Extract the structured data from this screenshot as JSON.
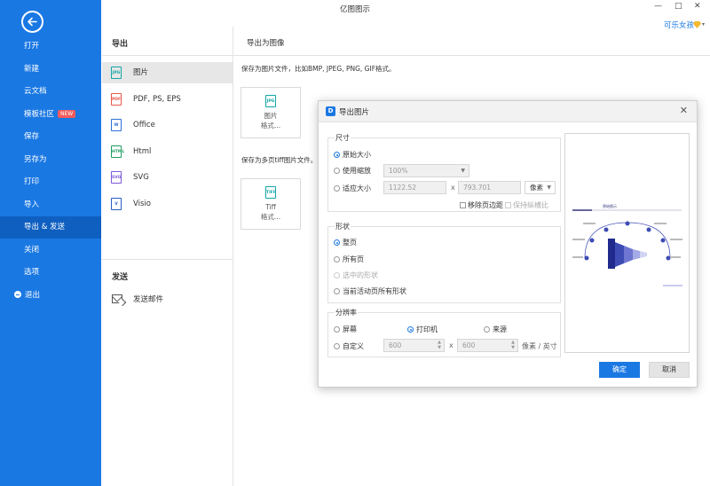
{
  "window": {
    "title": "亿图图示",
    "minimize": "—",
    "maximize": "□",
    "close": "✕",
    "user_name": "可乐女孩",
    "user_caret": "▾"
  },
  "sidebar": {
    "items": [
      {
        "label": "打开"
      },
      {
        "label": "新建"
      },
      {
        "label": "云文档"
      },
      {
        "label": "模板社区",
        "badge": "NEW"
      },
      {
        "label": "保存"
      },
      {
        "label": "另存为"
      },
      {
        "label": "打印"
      },
      {
        "label": "导入"
      },
      {
        "label": "导出 & 发送"
      },
      {
        "label": "关闭"
      },
      {
        "label": "选项"
      },
      {
        "label": "退出"
      }
    ]
  },
  "export_panel": {
    "export_title": "导出",
    "export_items": [
      {
        "icon_text": "JPG",
        "label": "图片"
      },
      {
        "icon_text": "PDF",
        "label": "PDF, PS, EPS"
      },
      {
        "icon_text": "W",
        "label": "Office"
      },
      {
        "icon_text": "HTML",
        "label": "Html"
      },
      {
        "icon_text": "SVG",
        "label": "SVG"
      },
      {
        "icon_text": "V",
        "label": "Visio"
      }
    ],
    "send_title": "发送",
    "send_items": [
      {
        "label": "发送邮件"
      }
    ]
  },
  "content": {
    "tab_title": "导出为图像",
    "desc1": "保存为图片文件，比如BMP, JPEG, PNG, GIF格式。",
    "card1": {
      "icon_text": "JPG",
      "line1": "图片",
      "line2": "格式..."
    },
    "desc2": "保存为多页tiff图片文件。",
    "card2": {
      "icon_text": "TIFF",
      "line1": "Tiff",
      "line2": "格式..."
    }
  },
  "dialog": {
    "logo": "D",
    "title": "导出图片",
    "close": "✕",
    "size_group": {
      "title": "尺寸",
      "original": "原始大小",
      "use_zoom": "使用缩放",
      "zoom_value": "100%",
      "fit_size": "适应大小",
      "width": "1122.52",
      "height": "793.701",
      "times": "x",
      "unit": "像素",
      "remove_margin": "移除页边距",
      "keep_ratio": "保持纵横比"
    },
    "shape_group": {
      "title": "形状",
      "whole_page": "整页",
      "all_pages": "所有页",
      "selected_shapes": "选中的形状",
      "current_all": "当前活动页所有形状"
    },
    "resolution_group": {
      "title": "分辨率",
      "screen": "屏幕",
      "printer": "打印机",
      "source": "来源",
      "custom": "自定义",
      "dpi_x": "600",
      "dpi_y": "600",
      "times": "x",
      "unit": "像素 / 英寸"
    },
    "preview": {
      "diagram_title": "原始图示"
    },
    "ok": "确定",
    "cancel": "取消"
  }
}
